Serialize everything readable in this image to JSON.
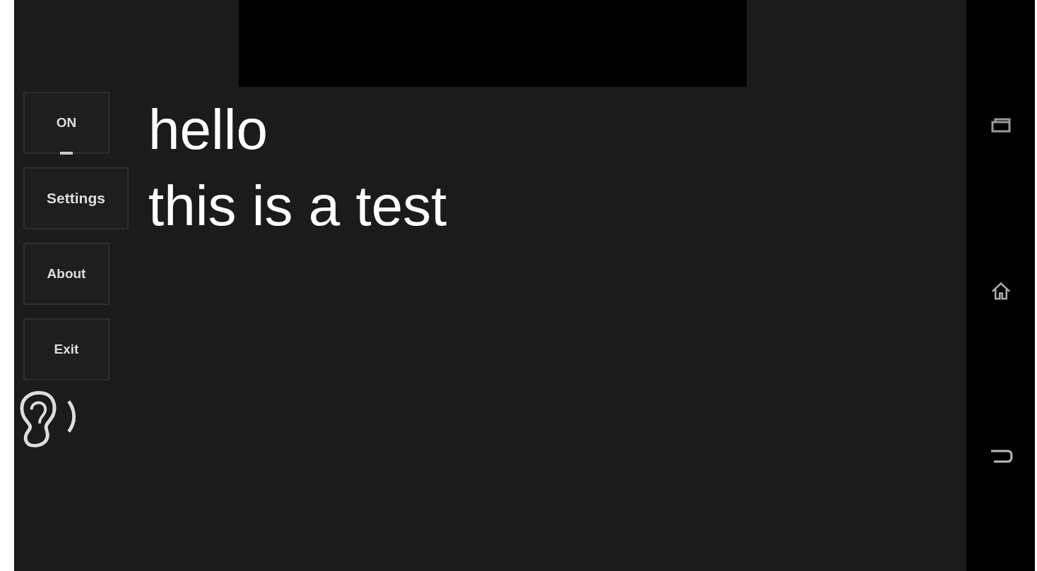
{
  "menu": [
    {
      "kind": "toggle",
      "label": "ON",
      "on": true
    },
    {
      "kind": "button",
      "label": "Settings"
    },
    {
      "kind": "button",
      "label": "About"
    },
    {
      "kind": "button",
      "label": "Exit"
    }
  ],
  "transcript": [
    "hello",
    "this is a test"
  ],
  "listening": true
}
